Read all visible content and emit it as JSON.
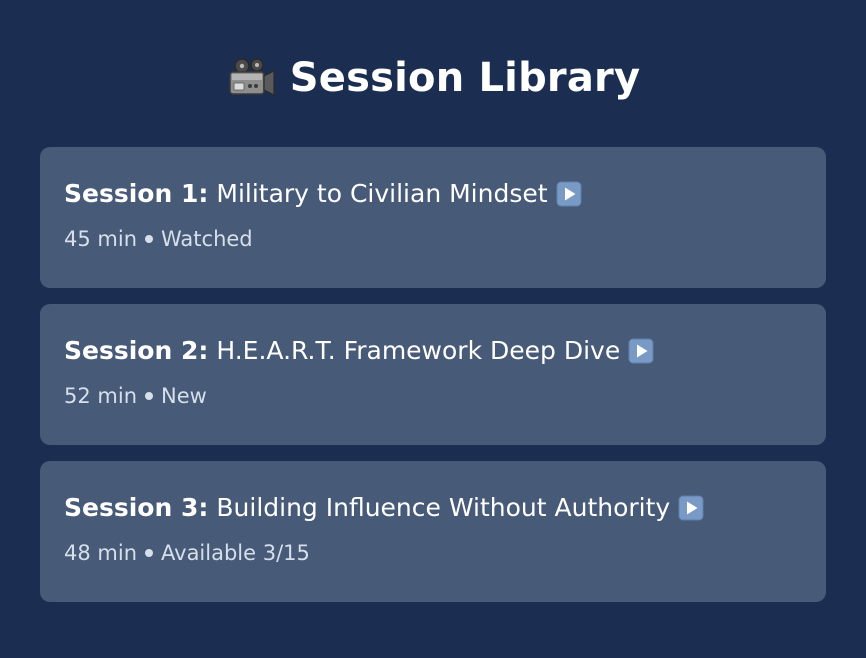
{
  "header": {
    "icon": "video-camera-icon",
    "title": "Session Library"
  },
  "sessions": [
    {
      "number_label": "Session 1:",
      "title": "Military to Civilian Mindset",
      "duration": "45 min",
      "status": "Watched",
      "icon": "play-button-icon"
    },
    {
      "number_label": "Session 2:",
      "title": "H.E.A.R.T. Framework Deep Dive",
      "duration": "52 min",
      "status": "New",
      "icon": "play-button-icon"
    },
    {
      "number_label": "Session 3:",
      "title": "Building Influence Without Authority",
      "duration": "48 min",
      "status": "Available 3/15",
      "icon": "play-button-icon"
    }
  ],
  "colors": {
    "background": "#1b2d50",
    "card": "#475a77",
    "text": "#ffffff",
    "meta_text": "#d7dfeb",
    "play_icon": "#7a9ac6"
  }
}
